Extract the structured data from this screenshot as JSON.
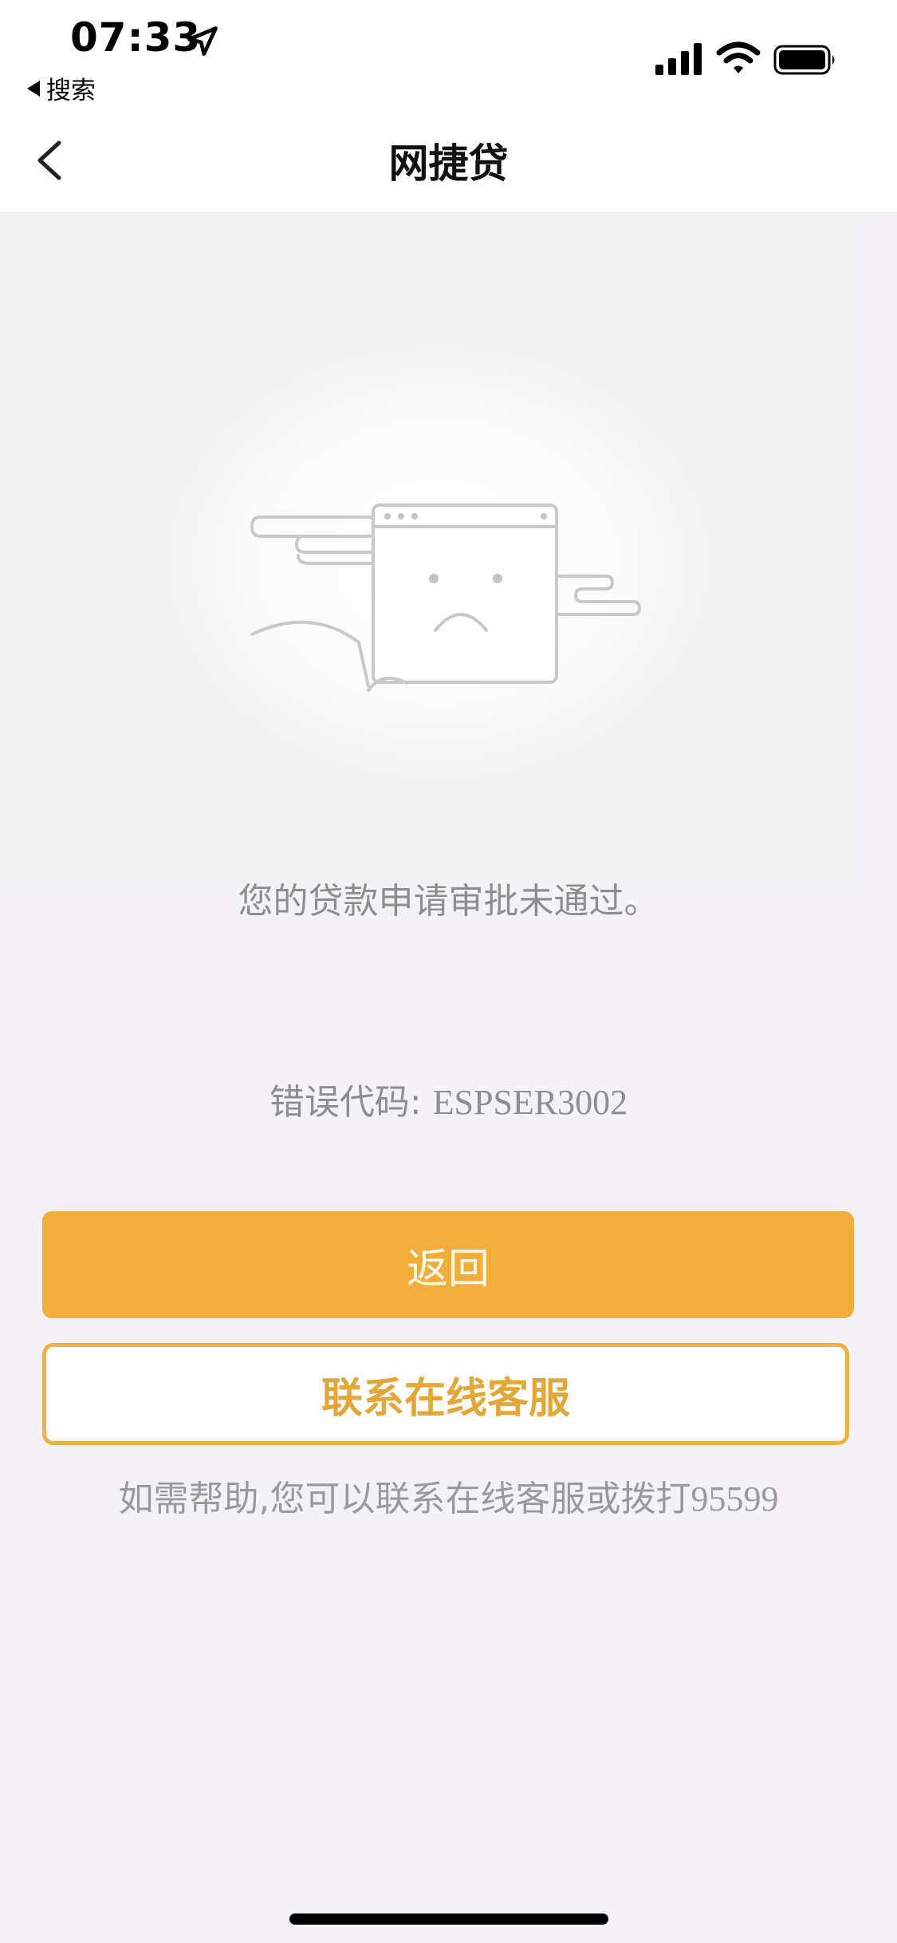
{
  "status_bar": {
    "time": "07:33",
    "back_app_label": "搜索",
    "icons": [
      "location-arrow-icon",
      "cellular-signal-icon",
      "wifi-icon",
      "battery-icon"
    ]
  },
  "nav": {
    "title": "网捷贷",
    "back_icon": "chevron-left-icon"
  },
  "illustration": {
    "icon": "sad-browser-window-icon"
  },
  "content": {
    "message": "您的贷款申请审批未通过。",
    "error_code_label": "错误代码: ",
    "error_code_value": "ESPSER3002",
    "primary_button": "返回",
    "secondary_button": "联系在线客服",
    "help_text": "如需帮助,您可以联系在线客服或拨打",
    "help_phone": "95599"
  },
  "colors": {
    "primary": "#f2ae3d",
    "outline": "#efb240",
    "background": "#f5f2f7"
  }
}
